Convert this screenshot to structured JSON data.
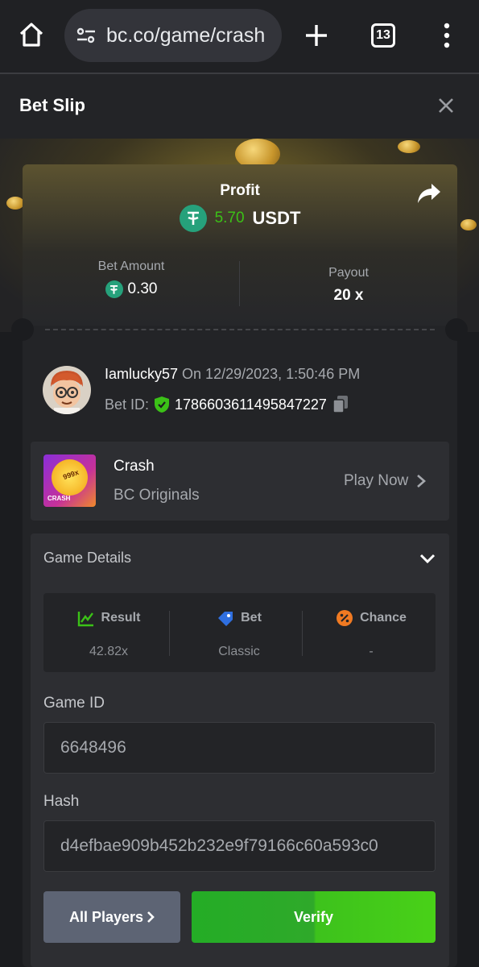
{
  "browser": {
    "url": "bc.co/game/crash",
    "tab_count": "13"
  },
  "header": {
    "title": "Bet Slip"
  },
  "profit": {
    "label": "Profit",
    "value": "5.70",
    "currency": "USDT"
  },
  "stats": {
    "bet_amount_label": "Bet Amount",
    "bet_amount_value": "0.30",
    "payout_label": "Payout",
    "payout_value": "20 x"
  },
  "user": {
    "name": "Iamlucky57",
    "date": " On 12/29/2023, 1:50:46 PM",
    "bet_id_label": "Bet ID:",
    "bet_id": "1786603611495847227"
  },
  "game": {
    "name": "Crash",
    "provider": "BC Originals",
    "play_label": "Play Now",
    "thumb_badge": "999x",
    "thumb_text": "CRASH"
  },
  "details": {
    "title": "Game Details",
    "result_label": "Result",
    "result_value": "42.82x",
    "bet_label": "Bet",
    "bet_value": "Classic",
    "chance_label": "Chance",
    "chance_value": "-",
    "game_id_label": "Game ID",
    "game_id": "6648496",
    "hash_label": "Hash",
    "hash": "d4efbae909b452b232e9f79166c60a593c0"
  },
  "buttons": {
    "all_players": "All Players",
    "verify": "Verify"
  },
  "colors": {
    "profit_green": "#3bc117",
    "tether": "#26a17b",
    "verify": "#2fa92a"
  }
}
